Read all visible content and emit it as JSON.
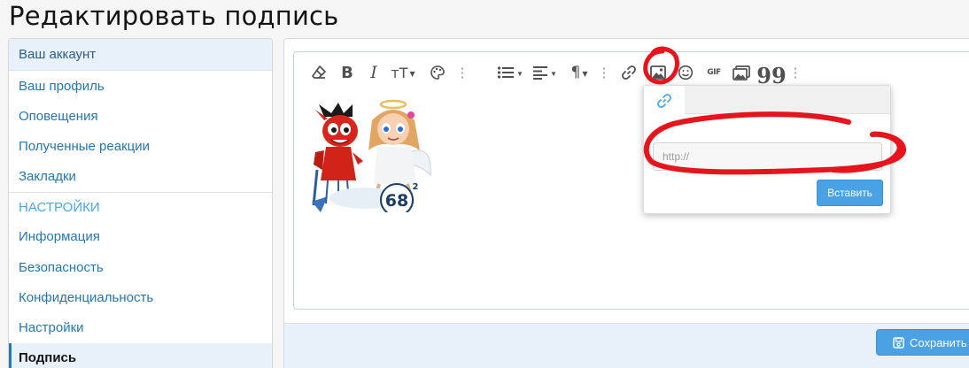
{
  "page": {
    "title": "Редактировать подпись"
  },
  "sidebar": {
    "header": "Ваш аккаунт",
    "items": [
      {
        "label": "Ваш профиль"
      },
      {
        "label": "Оповещения"
      },
      {
        "label": "Полученные реакции"
      },
      {
        "label": "Закладки"
      }
    ],
    "section": "НАСТРОЙКИ",
    "settings_items": [
      {
        "label": "Информация"
      },
      {
        "label": "Безопасность"
      },
      {
        "label": "Конфиденциальность"
      },
      {
        "label": "Настройки"
      },
      {
        "label": "Подпись",
        "active": true
      }
    ]
  },
  "editor": {
    "toolbar": {
      "text_size_label": "тТ",
      "gif_label": "GIF",
      "icons": [
        "eraser-icon",
        "bold-icon",
        "italic-icon",
        "text-size-icon",
        "palette-icon",
        "more-dots-icon",
        "list-icon",
        "align-icon",
        "paragraph-icon",
        "more-dots-icon",
        "link-icon",
        "image-icon",
        "smile-icon",
        "gif-icon",
        "media-icon",
        "quote-icon",
        "more-dots-icon"
      ]
    },
    "signature_image": {
      "badge_text": "68",
      "badge_sup": "2"
    }
  },
  "image_popup": {
    "tab_icon": "link-icon",
    "url_placeholder": "http://",
    "url_value": "",
    "insert_label": "Вставить"
  },
  "footer": {
    "save_label": "Сохранить"
  },
  "colors": {
    "accent": "#2577b1",
    "button": "#4aa1e3",
    "highlight_bg": "#e8f1fa",
    "annotation": "#e8141c"
  }
}
